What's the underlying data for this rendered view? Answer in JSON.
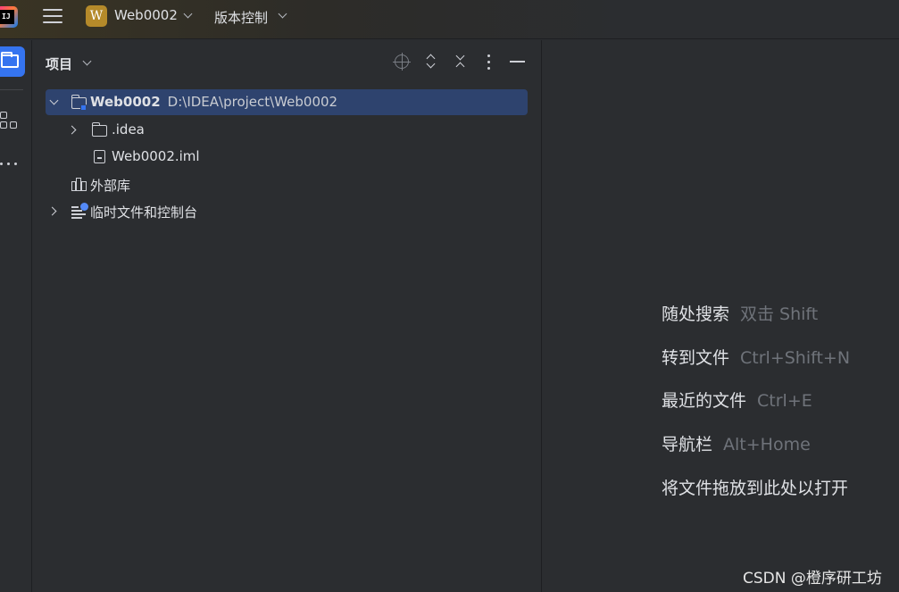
{
  "titlebar": {
    "project_badge": "W",
    "project_name": "Web0002",
    "vcs_label": "版本控制"
  },
  "project_panel": {
    "title": "项目",
    "tree": [
      {
        "label": "Web0002",
        "path": "D:\\IDEA\\project\\Web0002",
        "expanded": true,
        "selected": true
      },
      {
        "label": ".idea",
        "expanded": false
      },
      {
        "label": "Web0002.iml"
      },
      {
        "label": "外部库"
      },
      {
        "label": "临时文件和控制台",
        "expanded": false
      }
    ]
  },
  "editor": {
    "hints": [
      {
        "action": "随处搜索",
        "shortcut": "双击 Shift"
      },
      {
        "action": "转到文件",
        "shortcut": "Ctrl+Shift+N"
      },
      {
        "action": "最近的文件",
        "shortcut": "Ctrl+E"
      },
      {
        "action": "导航栏",
        "shortcut": "Alt+Home"
      },
      {
        "action": "将文件拖放到此处以打开",
        "shortcut": ""
      }
    ]
  },
  "watermark": "CSDN @橙序研工坊",
  "colors": {
    "accent": "#3574f0",
    "selection": "#2e436e",
    "badge": "#b58a2a"
  }
}
